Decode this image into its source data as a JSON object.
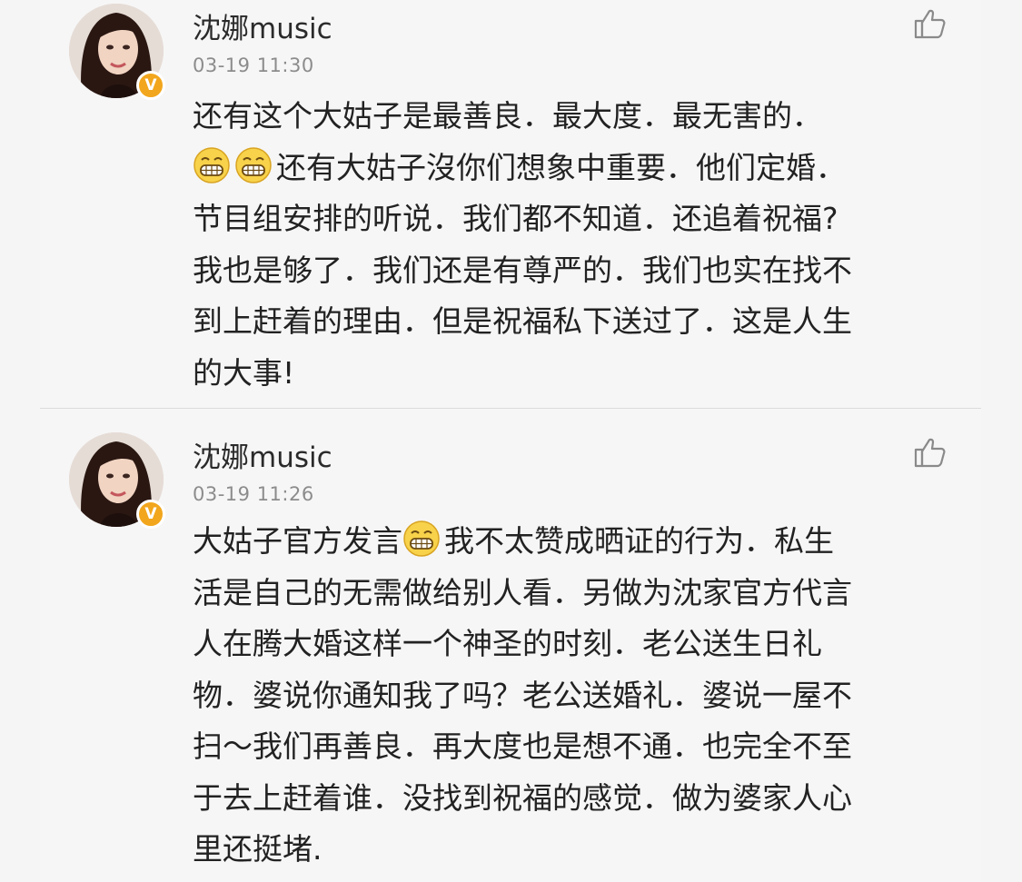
{
  "comments": [
    {
      "username": "沈娜music",
      "time": "03-19 11:30",
      "verified_badge": "V",
      "lines": [
        [
          {
            "t": "还有这个大姑子是最善良．最大度．最无害的．"
          }
        ],
        [
          {
            "emoji": "grin-emoji"
          },
          {
            "emoji": "grin-emoji"
          },
          {
            "t": "还有大姑子沒你们想象中重要．他们定婚．"
          }
        ],
        [
          {
            "t": "节目组安排的听说．我们都不知道．还追着祝福?"
          }
        ],
        [
          {
            "t": "我也是够了．我们还是有尊严的．我们也实在找不"
          }
        ],
        [
          {
            "t": "到上赶着的理由．但是祝福私下送过了．这是人生"
          }
        ],
        [
          {
            "t": "的大事!"
          }
        ]
      ]
    },
    {
      "username": "沈娜music",
      "time": "03-19 11:26",
      "verified_badge": "V",
      "lines": [
        [
          {
            "t": "大姑子官方发言"
          },
          {
            "emoji": "grin-emoji"
          },
          {
            "t": "我不太赞成晒证的行为．私生"
          }
        ],
        [
          {
            "t": "活是自己的无需做给别人看．另做为沈家官方代言"
          }
        ],
        [
          {
            "t": "人在腾大婚这样一个神圣的时刻．老公送生日礼"
          }
        ],
        [
          {
            "t": "物．婆说你通知我了吗？老公送婚礼．婆说一屋不"
          }
        ],
        [
          {
            "t": "扫～我们再善良．再大度也是想不通．也完全不至"
          }
        ],
        [
          {
            "t": "于去上赶着谁．没找到祝福的感觉．做为婆家人心"
          }
        ],
        [
          {
            "t": "里还挺堵."
          }
        ]
      ]
    }
  ],
  "colors": {
    "background": "#f6f6f6",
    "text": "#222222",
    "meta": "#8c8c8c",
    "badge": "#f2a61d"
  },
  "icons": {
    "like": "thumbs-up-icon",
    "emoji": "grin-emoji"
  }
}
